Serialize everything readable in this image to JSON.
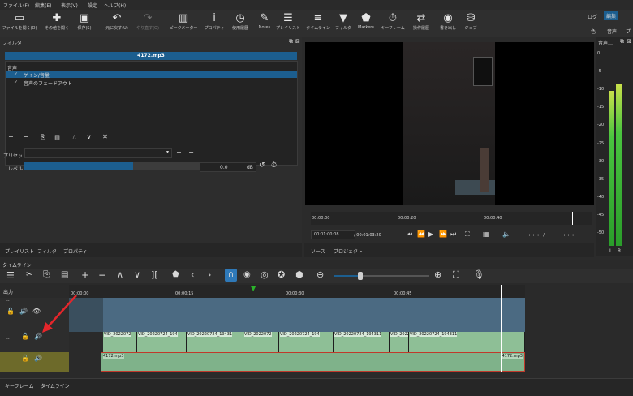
{
  "menu": [
    "ファイル(F)",
    "編集(E)",
    "表示(V)",
    "設定",
    "ヘルプ(H)"
  ],
  "toolbar": {
    "items": [
      {
        "label": "ファイルを開く(O)",
        "icon": "folder-open-icon"
      },
      {
        "label": "その他を開く",
        "icon": "open-other-icon"
      },
      {
        "label": "保存(S)",
        "icon": "save-icon"
      },
      {
        "label": "元に戻す(U)",
        "icon": "undo-icon"
      },
      {
        "label": "やり直す(O)",
        "icon": "redo-icon"
      },
      {
        "label": "ピークメーター",
        "icon": "peak-meter-icon"
      },
      {
        "label": "プロパティ",
        "icon": "info-icon"
      },
      {
        "label": "使用履歴",
        "icon": "history-icon"
      },
      {
        "label": "Notes",
        "icon": "notes-icon"
      },
      {
        "label": "プレイリスト",
        "icon": "playlist-icon"
      },
      {
        "label": "タイムライン",
        "icon": "timeline-icon"
      },
      {
        "label": "フィルタ",
        "icon": "filter-icon"
      },
      {
        "label": "Markers",
        "icon": "markers-icon"
      },
      {
        "label": "キーフレーム",
        "icon": "keyframe-icon"
      },
      {
        "label": "操作履歴",
        "icon": "jobs-icon"
      },
      {
        "label": "書き出し",
        "icon": "export-icon"
      },
      {
        "label": "ジョブ",
        "icon": "jobs-stack-icon"
      }
    ],
    "right_top": [
      "ログ",
      "編集"
    ],
    "right_bottom": [
      "色",
      "音声",
      "プレ"
    ]
  },
  "filters": {
    "title": "フィルタ",
    "clip_name": "4172.mp3",
    "category": "音声",
    "items": [
      {
        "check": "✓",
        "label": "ゲイン/音量"
      },
      {
        "check": "✓",
        "label": "音声のフェードアウト"
      }
    ],
    "preset_label": "プリセット",
    "level_label": "レベル",
    "level_value": "0.0",
    "level_unit": "dB",
    "level_fill": 0.62,
    "tabs": [
      "プレイリスト",
      "フィルタ",
      "プロパティ"
    ]
  },
  "meter": {
    "title": "音声…",
    "scale": [
      "0",
      "-5",
      "-10",
      "-15",
      "-20",
      "-25",
      "-30",
      "-35",
      "-40",
      "-45",
      "-50"
    ],
    "channels": [
      "L",
      "R"
    ],
    "levels_db": [
      -10.5,
      -8.5
    ]
  },
  "player": {
    "ruler": [
      "00:00:00",
      "00:00:20",
      "00:00:40"
    ],
    "timecode": "00:01:00:08",
    "duration": "/ 00:01:03:20",
    "in_point": "--:--:--:--  /",
    "out_point": "--:--:--:--",
    "tabs": [
      "ソース",
      "プロジェクト"
    ]
  },
  "timeline": {
    "title": "タイムライン",
    "output_label": "出力",
    "ruler": [
      "00:00:00",
      "00:00:15",
      "00:00:30",
      "00:00:45"
    ],
    "video_clips": [
      "VID_2022072",
      "VID_20220724_194",
      "VID_20220724_19431",
      "VID_2022072",
      "VID_20220724_194",
      "VID_20220724_194311",
      "VID_2022",
      "VID_20220724_194311"
    ],
    "audio_clip_start": "4172.mp3",
    "audio_clip_end": "4172.mp3",
    "track_dots": "..",
    "bottom_tabs": [
      "キーフレーム",
      "タイムライン"
    ]
  },
  "colors": {
    "accent": "#1c5e8f",
    "video_track": "#4b6a82",
    "audio_clip": "#7fb28a",
    "selected_track": "#6d6a2a",
    "playhead": "#ffffff",
    "arrow": "#e5262b"
  }
}
